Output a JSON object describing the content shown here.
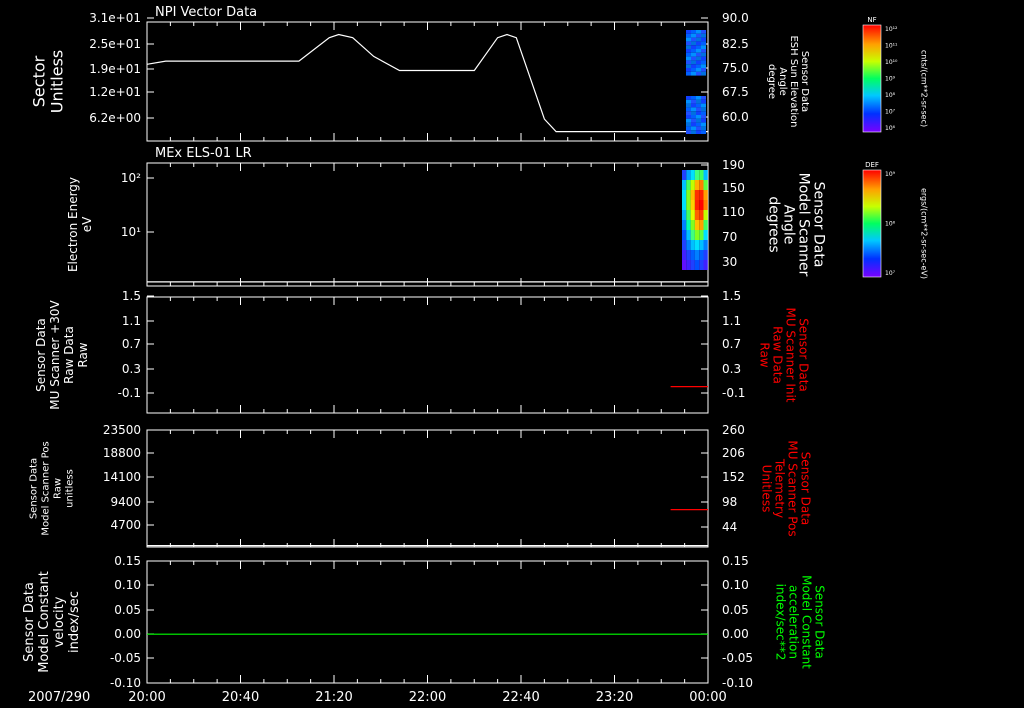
{
  "chart_data": [
    {
      "type": "line",
      "title": "NPI Vector Data",
      "ylabel_left": [
        "Sector",
        "Unitless"
      ],
      "left_ticks": [
        "3.1e+01",
        "2.5e+01",
        "1.9e+01",
        "1.2e+01",
        "6.2e+00"
      ],
      "ylabel_right": [
        "Sensor Data",
        "ESH Sun Elevation",
        "Angle",
        "degree"
      ],
      "right_ticks": [
        "90.0",
        "82.5",
        "75.0",
        "67.5",
        "60.0"
      ],
      "right_range": [
        53,
        91
      ],
      "series": [
        {
          "color": "#ffffff",
          "x": [
            "20:00",
            "20:08",
            "21:05",
            "21:18",
            "21:22",
            "21:28",
            "21:37",
            "21:48",
            "22:20",
            "22:30",
            "22:34",
            "22:38",
            "22:44",
            "22:50",
            "22:55",
            "23:00",
            "23:40",
            "24:00"
          ],
          "y": [
            77.5,
            78.5,
            78.5,
            86.0,
            87.0,
            86.0,
            80.0,
            75.5,
            75.5,
            86.0,
            87.0,
            86.0,
            73.0,
            60.0,
            56.0,
            56.0,
            56.0,
            56.0
          ]
        }
      ],
      "colorbar": {
        "label": "NF",
        "units": "cnts/(cm**2-sr-sec)",
        "tick_labels": [
          "10¹²",
          "10¹¹",
          "10¹⁰",
          "10⁹",
          "10⁸",
          "10⁷",
          "10⁶"
        ]
      }
    },
    {
      "type": "heatmap",
      "title": "MEx ELS-01 LR",
      "ylabel_left": [
        "Electron Energy",
        "eV"
      ],
      "left_ticks": [
        "10²",
        "10¹"
      ],
      "ylabel_right": [
        "Sensor Data",
        "Model Scanner",
        "Angle",
        "degrees"
      ],
      "right_ticks": [
        "190",
        "150",
        "110",
        "70",
        "30"
      ],
      "right_range": [
        10,
        190
      ],
      "series": [
        {
          "color": "#ffffff",
          "x": [
            "20:00",
            "24:00"
          ],
          "y": [
            16,
            16
          ]
        }
      ],
      "colorbar": {
        "label": "DEF",
        "units": "ergs/(cm**2-sr-sec-eV)",
        "tick_labels": [
          "10⁹",
          "10⁸",
          "10⁷"
        ]
      }
    },
    {
      "type": "line",
      "ylabel_left": [
        "Sensor Data",
        "MU Scanner +30V",
        "Raw Data",
        "Raw"
      ],
      "left_ticks": [
        "1.5",
        "1.1",
        "0.7",
        "0.3",
        "-0.1"
      ],
      "ylabel_right": [
        "Sensor Data",
        "MU Scanner Init",
        "Raw Data",
        "Raw"
      ],
      "right_ticks": [
        "1.5",
        "1.1",
        "0.7",
        "0.3",
        "-0.1"
      ],
      "right_range": [
        -0.3,
        1.5
      ],
      "series": [
        {
          "color": "#ff0000",
          "x": [
            "23:44",
            "24:00"
          ],
          "y": [
            0.11,
            0.11
          ]
        }
      ]
    },
    {
      "type": "line",
      "ylabel_left": [
        "Sensor Data",
        "Model Scanner Pos",
        "Raw",
        "unitless"
      ],
      "left_ticks": [
        "23500",
        "18800",
        "14100",
        "9400",
        "4700"
      ],
      "ylabel_right": [
        "Sensor Data",
        "MU Scanner Pos",
        "Telemetry",
        "Unitless"
      ],
      "right_ticks": [
        "260",
        "206",
        "152",
        "98",
        "44"
      ],
      "right_range": [
        0,
        260
      ],
      "series": [
        {
          "color": "#ff0000",
          "x": [
            "23:44",
            "24:00"
          ],
          "y": [
            83,
            83
          ]
        },
        {
          "color": "#ffffff",
          "x": [
            "20:00",
            "24:00"
          ],
          "y": [
            3,
            3
          ]
        }
      ]
    },
    {
      "type": "line",
      "ylabel_left": [
        "Sensor Data",
        "Model Constant",
        "velocity",
        "index/sec"
      ],
      "left_ticks": [
        "0.15",
        "0.10",
        "0.05",
        "0.00",
        "-0.05",
        "-0.10"
      ],
      "ylabel_right": [
        "Sensor Data",
        "Model Constant",
        "acceleration",
        "index/sec**2"
      ],
      "right_ticks": [
        "0.15",
        "0.10",
        "0.05",
        "0.00",
        "-0.05",
        "-0.10"
      ],
      "right_range": [
        -0.1,
        0.15
      ],
      "series": [
        {
          "color": "#00ff00",
          "x": [
            "20:00",
            "24:00"
          ],
          "y": [
            0.0,
            0.0
          ]
        }
      ]
    }
  ],
  "x_axis": {
    "date_label": "2007/290",
    "tick_labels": [
      "20:00",
      "20:40",
      "21:20",
      "22:00",
      "22:40",
      "23:20",
      "00:00"
    ]
  },
  "colors": {
    "background": "#000000",
    "foreground": "#ffffff",
    "red_label": "#ff0000",
    "green_label": "#00ff00"
  }
}
